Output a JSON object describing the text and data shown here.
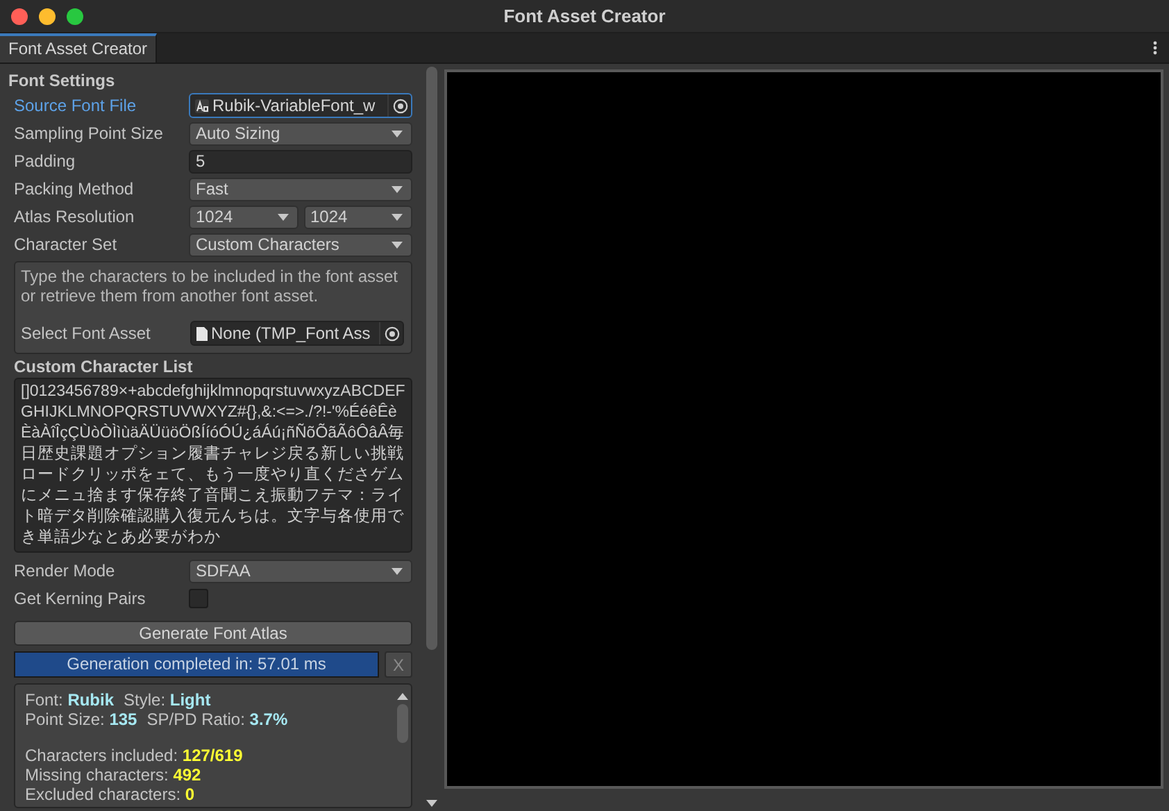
{
  "window": {
    "title": "Font Asset Creator"
  },
  "tabs": [
    {
      "label": "Font Asset Creator",
      "selected": true
    }
  ],
  "section_title": "Font Settings",
  "fields": [
    {
      "kind": "object",
      "label": "Source Font File",
      "value": "Rubik-VariableFont_w",
      "focused": true
    },
    {
      "kind": "dropdown",
      "label": "Sampling Point Size",
      "value": "Auto Sizing",
      "focused": false
    },
    {
      "kind": "text",
      "label": "Padding",
      "value": "5",
      "focused": false
    },
    {
      "kind": "dropdown",
      "label": "Packing Method",
      "value": "Fast",
      "focused": false
    },
    {
      "kind": "dual_dropdown",
      "label": "Atlas Resolution",
      "values": [
        "1024",
        "1024"
      ],
      "focused": false
    },
    {
      "kind": "dropdown",
      "label": "Character Set",
      "value": "Custom Characters",
      "focused": false
    }
  ],
  "character_help": {
    "text": "Type the characters to be included in the font asset or retrieve them from another font asset.",
    "asset_label": "Select Font Asset",
    "asset_value": "None (TMP_Font Ass"
  },
  "custom_list": {
    "label": "Custom Character List",
    "value": "[]0123456789×+abcdefghijklmnopqrstuvwxyzABCDEFGHIJKLMNOPQRSTUVWXYZ#{},&:<=>./?!-'%ÉéêÊèÈàÀîÎçÇÙòÒÌìùäÄÜüöÖßÍíóÓÚ¿áÁú¡ñÑõÕãÃôÔâÂ毎日歴史課題オプション履書チャレジ戻る新しい挑戦ロードクリッポをェて、もう一度やり直くださゲムにメニュ捨ます保存終了音聞こえ振動フテマ：ライト暗デタ削除確認購入復元んちは。文字与各使用でき単語少なとあ必要がわか"
  },
  "render_fields": [
    {
      "kind": "dropdown",
      "label": "Render Mode",
      "value": "SDFAA"
    },
    {
      "kind": "checkbox",
      "label": "Get Kerning Pairs",
      "checked": false
    }
  ],
  "generate_button": "Generate Font Atlas",
  "progress": {
    "text": "Generation completed in: 57.01 ms",
    "level": 1,
    "close": "X"
  },
  "info_groups": [
    [
      [
        {
          "label": "Font:",
          "value": "Rubik",
          "color": "#a6e8f2"
        },
        {
          "label": "Style:",
          "value": "Light",
          "color": "#a6e8f2"
        }
      ],
      [
        {
          "label": "Point Size:",
          "value": "135",
          "color": "#a6e8f2"
        },
        {
          "label": "SP/PD Ratio:",
          "value": "3.7%",
          "color": "#a6e8f2"
        }
      ]
    ],
    [
      [
        {
          "label": "Characters included:",
          "value": "127/619",
          "color": "#ffff33"
        }
      ],
      [
        {
          "label": "Missing characters:",
          "value": "492",
          "color": "#ffff33"
        }
      ],
      [
        {
          "label": "Excluded characters:",
          "value": "0",
          "color": "#ffff33"
        }
      ]
    ]
  ]
}
